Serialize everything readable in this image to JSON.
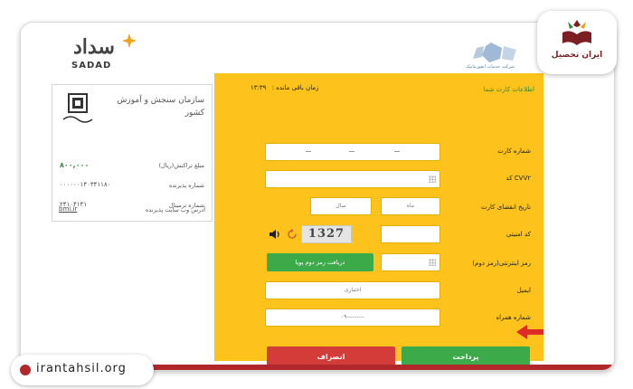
{
  "header": {
    "sadad_fa": "سداد",
    "sadad_en": "SADAD",
    "bank_caption": "شرکت خدمات انفورماتیک"
  },
  "receipt": {
    "org_name": "سازمان سنجش و آموزش کشور",
    "rows": [
      {
        "label": "مبلغ تراکنش(ریال)",
        "value": "۸۰۰,۰۰۰"
      },
      {
        "label": "شماره پذیرنده",
        "value": "۰۰۰۰۰۰۱۴۰۳۴۱۱۸۰"
      },
      {
        "label": "شماره ترمینال",
        "value": "۲۴۱۰۴۱۴۱"
      },
      {
        "label": "آدرس وب سایت پذیرنده",
        "value": "bmi.ir"
      }
    ]
  },
  "form": {
    "title": "اطلاعات کارت شما",
    "timer_label": "زمان باقی مانده :",
    "timer_value": "۱۳:۳۹",
    "labels": {
      "card_number": "شماره کارت",
      "cvv2": "کد CVV۲",
      "expiry": "تاریخ انقضای کارت",
      "captcha": "کد امنیتی",
      "internet_pin": "رمز اینترنتی(رمز دوم)",
      "email": "ایمیل",
      "mobile": "شماره همراه"
    },
    "expiry_month_placeholder": "ماه",
    "expiry_year_placeholder": "سال",
    "captcha_text": "1327",
    "get_otp_button": "دریافت رمز دوم پویا",
    "email_placeholder": "اختیاری",
    "mobile_value": "۰۹---------",
    "pay_button": "پرداخت",
    "cancel_button": "انصراف"
  },
  "watermark": {
    "site": "irantahsil.org",
    "brand": "ایران تحصیل"
  },
  "colors": {
    "panel": "#fdc21c",
    "green": "#3daa4a",
    "red": "#d43c3a",
    "accent": "#b1282b"
  }
}
